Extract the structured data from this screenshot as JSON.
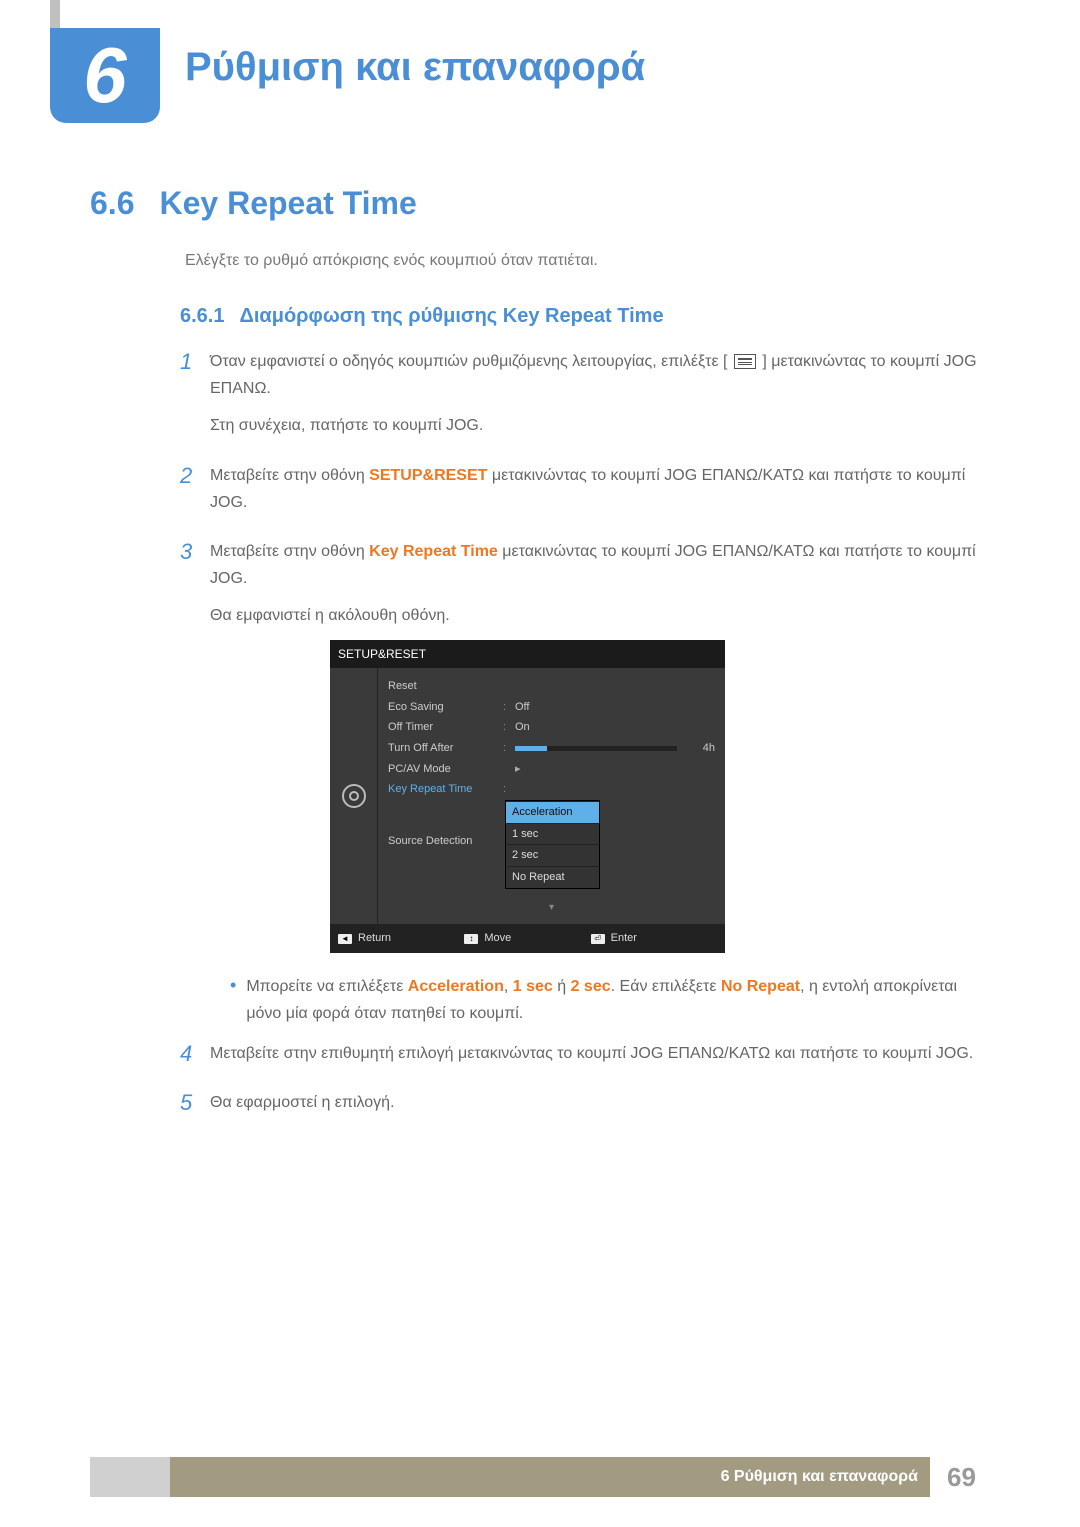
{
  "chapter": {
    "number": "6",
    "title": "Ρύθμιση και επαναφορά"
  },
  "section": {
    "number": "6.6",
    "title": "Key Repeat Time",
    "intro": "Ελέγξτε το ρυθμό απόκρισης ενός κουμπιού όταν πατιέται."
  },
  "subsection": {
    "number": "6.6.1",
    "title": "Διαμόρφωση της ρύθμισης Key Repeat Time"
  },
  "steps": {
    "s1": {
      "num": "1",
      "p1a": "Όταν εμφανιστεί ο οδηγός κουμπιών ρυθμιζόμενης λειτουργίας, επιλέξτε [",
      "p1b": "] μετακινώντας το κουμπί JOG ΕΠΑΝΩ.",
      "p2": "Στη συνέχεια, πατήστε το κουμπί JOG."
    },
    "s2": {
      "num": "2",
      "t1": "Μεταβείτε στην οθόνη ",
      "hl": "SETUP&RESET",
      "t2": " μετακινώντας το κουμπί JOG ΕΠΑΝΩ/ΚΑΤΩ και πατήστε το κουμπί JOG."
    },
    "s3": {
      "num": "3",
      "t1": "Μεταβείτε στην οθόνη ",
      "hl": "Key Repeat Time",
      "t2": " μετακινώντας το κουμπί JOG ΕΠΑΝΩ/ΚΑΤΩ και πατήστε το κουμπί JOG.",
      "p2": "Θα εμφανιστεί η ακόλουθη οθόνη."
    },
    "bullet": {
      "t1": "Μπορείτε να επιλέξετε ",
      "hl1": "Acceleration",
      "sep1": ", ",
      "hl2": "1 sec",
      "sep2": " ή ",
      "hl3": "2 sec",
      "t2": ". Εάν επιλέξετε ",
      "hl4": "No Repeat",
      "t3": ", η εντολή αποκρίνεται μόνο μία φορά όταν πατηθεί το κουμπί."
    },
    "s4": {
      "num": "4",
      "text": "Μεταβείτε στην επιθυμητή επιλογή μετακινώντας το κουμπί JOG ΕΠΑΝΩ/ΚΑΤΩ και πατήστε το κουμπί JOG."
    },
    "s5": {
      "num": "5",
      "text": "Θα εφαρμοστεί η επιλογή."
    }
  },
  "osd": {
    "title": "SETUP&RESET",
    "rows": {
      "reset": "Reset",
      "eco": "Eco Saving",
      "eco_val": "Off",
      "timer": "Off Timer",
      "timer_val": "On",
      "turnoff": "Turn Off After",
      "turnoff_val": "4h",
      "pcav": "PC/AV Mode",
      "key": "Key Repeat Time",
      "source": "Source Detection"
    },
    "popup": {
      "o1": "Acceleration",
      "o2": "1 sec",
      "o3": "2 sec",
      "o4": "No Repeat"
    },
    "footer": {
      "return": "Return",
      "move": "Move",
      "enter": "Enter"
    }
  },
  "footer": {
    "label": "6 Ρύθμιση και επαναφορά",
    "page": "69"
  }
}
